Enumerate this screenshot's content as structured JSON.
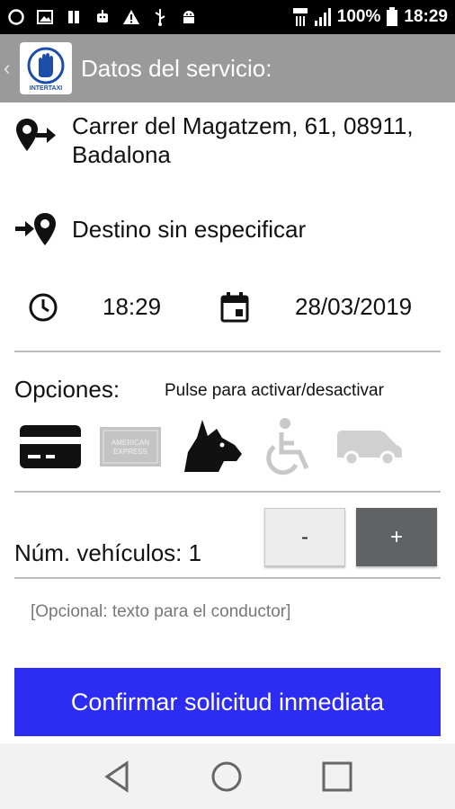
{
  "status_bar": {
    "battery": "100%",
    "time": "18:29",
    "colors": {
      "background": "#000000",
      "foreground": "#ffffff"
    }
  },
  "app_bar": {
    "title": "Datos del servicio:",
    "logo_text": "INTERTAXI",
    "color": "#9a9a9a"
  },
  "origin": {
    "line1": "Carrer del Magatzem, 61, 08911,",
    "line2": "Badalona",
    "icon": "pin-arrow-right-icon"
  },
  "destination": {
    "text": "Destino sin especificar",
    "icon": "arrow-pin-icon"
  },
  "schedule": {
    "time": "18:29",
    "date": "28/03/2019"
  },
  "options": {
    "label": "Opciones:",
    "hint": "Pulse para activar/desactivar",
    "items": [
      {
        "name": "credit-card-icon",
        "active": true
      },
      {
        "name": "american-express-icon",
        "active": false,
        "text": "AMERICAN EXPRESS"
      },
      {
        "name": "dog-icon",
        "active": true
      },
      {
        "name": "wheelchair-icon",
        "active": false
      },
      {
        "name": "van-icon",
        "active": false
      }
    ]
  },
  "vehicles": {
    "label": "Núm. vehículos: 1",
    "minus_label": "-",
    "plus_label": "+"
  },
  "note": {
    "placeholder": "[Opcional: texto para el conductor]"
  },
  "confirm": {
    "label": "Confirmar solicitud inmediata",
    "color": "#2c2cf2"
  },
  "nav": {
    "items": [
      "back-icon",
      "home-icon",
      "recents-icon"
    ]
  }
}
